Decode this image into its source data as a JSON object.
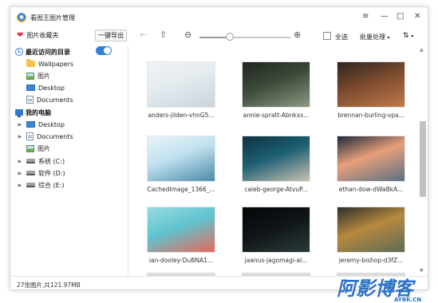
{
  "window": {
    "title": "看图王图片管理",
    "controls": [
      "≡",
      "—",
      "□",
      "✕"
    ]
  },
  "toolbar": {
    "favorites_label": "图片收藏夹",
    "export_label": "一键导出",
    "select_all_label": "全选",
    "batch_label": "批量处理",
    "sort_label": "⇅"
  },
  "sidebar": {
    "recent_header": "最近访问的目录",
    "recent_items": [
      "Wallpapers",
      "图片",
      "Desktop",
      "Documents"
    ],
    "pc_header": "我的电脑",
    "pc_items": [
      "Desktop",
      "Documents",
      "图片",
      "系统 (C:)",
      "软件 (D:)",
      "综合 (E:)"
    ]
  },
  "thumbnails": [
    {
      "name": "anders-jilden-vhnG5...",
      "colors": [
        "#e4ebef",
        "#c9d4dc",
        "#f0f3f5"
      ]
    },
    {
      "name": "annie-spratt-Abnkxs...",
      "colors": [
        "#3c4a3a",
        "#8d9780",
        "#20261e"
      ]
    },
    {
      "name": "brennan-burling-vpa...",
      "colors": [
        "#7a4a2e",
        "#c07a4a",
        "#2e2420"
      ]
    },
    {
      "name": "CachedImage_1366_...",
      "colors": [
        "#bfe0ee",
        "#4b8aa8",
        "#e9f4f8"
      ]
    },
    {
      "name": "caleb-george-AtvuP...",
      "colors": [
        "#1c5f73",
        "#c9c2b1",
        "#0e3340"
      ]
    },
    {
      "name": "ethan-dow-dWaBkA...",
      "colors": [
        "#e7a07a",
        "#5a6f84",
        "#1e2a3a"
      ]
    },
    {
      "name": "ian-dooley-DuBNA1...",
      "colors": [
        "#5fc3cf",
        "#e9685a",
        "#9adbe0"
      ]
    },
    {
      "name": "jaanus-jagomagi-al...",
      "colors": [
        "#0f1416",
        "#2a3a3a",
        "#050708"
      ]
    },
    {
      "name": "jeremy-bishop-d3fZ...",
      "colors": [
        "#b7893f",
        "#5d6b55",
        "#2a2f2a"
      ]
    }
  ],
  "status": {
    "summary": "27张图片,共121.97MB"
  },
  "watermark": {
    "main": "阿影博客",
    "sub": "AYBK.CN",
    "color": "#2a72c6"
  }
}
